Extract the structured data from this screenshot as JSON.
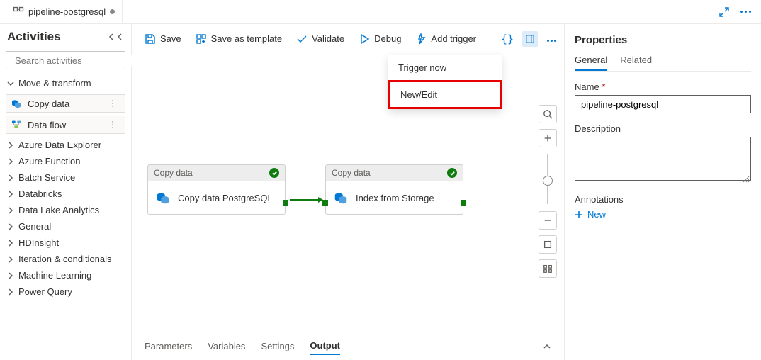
{
  "tab": {
    "title": "pipeline-postgresql"
  },
  "sidebar": {
    "title": "Activities",
    "search_placeholder": "Search activities",
    "group1": {
      "label": "Move & transform"
    },
    "items": [
      {
        "label": "Copy data"
      },
      {
        "label": "Data flow"
      }
    ],
    "categories": [
      "Azure Data Explorer",
      "Azure Function",
      "Batch Service",
      "Databricks",
      "Data Lake Analytics",
      "General",
      "HDInsight",
      "Iteration & conditionals",
      "Machine Learning",
      "Power Query"
    ]
  },
  "toolbar": {
    "save": "Save",
    "save_template": "Save as template",
    "validate": "Validate",
    "debug": "Debug",
    "add_trigger": "Add trigger"
  },
  "trigger_menu": {
    "trigger_now": "Trigger now",
    "new_edit": "New/Edit"
  },
  "canvas": {
    "node1": {
      "type": "Copy data",
      "name": "Copy data PostgreSQL"
    },
    "node2": {
      "type": "Copy data",
      "name": "Index from Storage"
    }
  },
  "bottom_tabs": {
    "parameters": "Parameters",
    "variables": "Variables",
    "settings": "Settings",
    "output": "Output"
  },
  "props": {
    "title": "Properties",
    "tab_general": "General",
    "tab_related": "Related",
    "name_label": "Name",
    "name_value": "pipeline-postgresql",
    "desc_label": "Description",
    "annot_label": "Annotations",
    "new": "New"
  }
}
